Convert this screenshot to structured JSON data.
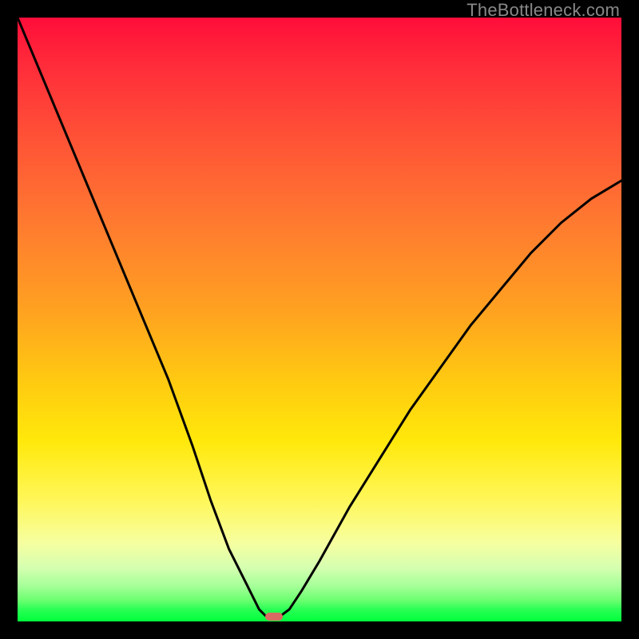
{
  "watermark": "TheBottleneck.com",
  "marker": {
    "x_pct": 42.5,
    "y_pct": 99.2
  },
  "chart_data": {
    "type": "line",
    "title": "",
    "xlabel": "",
    "ylabel": "",
    "xlim": [
      0,
      100
    ],
    "ylim": [
      0,
      100
    ],
    "series": [
      {
        "name": "bottleneck-curve",
        "x": [
          0,
          5,
          10,
          15,
          20,
          25,
          29,
          32,
          35,
          38,
          40,
          41.5,
          43,
          45,
          47,
          50,
          55,
          60,
          65,
          70,
          75,
          80,
          85,
          90,
          95,
          100
        ],
        "y": [
          100,
          88,
          76,
          64,
          52,
          40,
          29,
          20,
          12,
          6,
          2,
          0.5,
          0.5,
          2,
          5,
          10,
          19,
          27,
          35,
          42,
          49,
          55,
          61,
          66,
          70,
          73
        ]
      }
    ],
    "annotations": [
      {
        "type": "marker",
        "x": 42.5,
        "y": 0.8,
        "label": "optimal-point"
      }
    ],
    "background_gradient": {
      "direction": "vertical",
      "stops": [
        {
          "pct": 0,
          "color": "#ff0d3a"
        },
        {
          "pct": 50,
          "color": "#ffa021"
        },
        {
          "pct": 80,
          "color": "#fff75a"
        },
        {
          "pct": 100,
          "color": "#00ff3b"
        }
      ]
    }
  }
}
